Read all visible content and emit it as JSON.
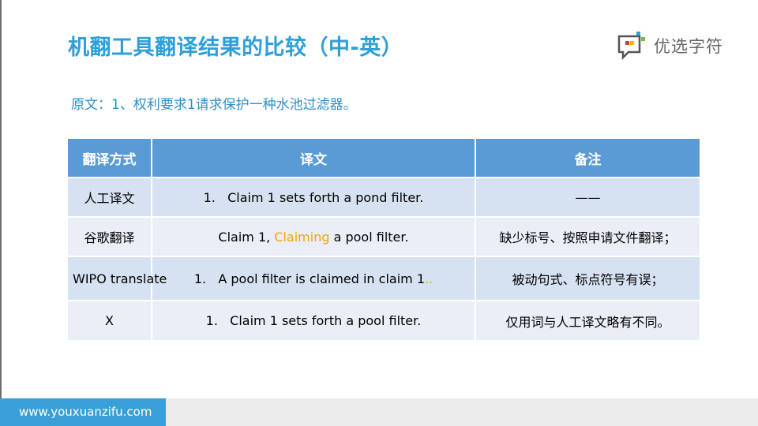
{
  "title": "机翻工具翻译结果的比较（中-英）",
  "logo": {
    "text": "优选字符"
  },
  "source_text": "原文：1、权利要求1请求保护一种水池过滤器。",
  "table": {
    "headers": [
      "翻译方式",
      "译文",
      "备注"
    ],
    "rows": [
      {
        "method": "人工译文",
        "text_pre": "1.   Claim 1 sets forth a pond filter.",
        "text_hl": "",
        "text_post": "",
        "note": "——"
      },
      {
        "method": "谷歌翻译",
        "text_pre": "Claim 1, ",
        "text_hl": "Claiming",
        "text_post": " a pool filter.",
        "note": "缺少标号、按照申请文件翻译；"
      },
      {
        "method": "WIPO translate",
        "text_pre": "1.   A pool filter is claimed in claim 1",
        "text_hl": "..",
        "text_post": "",
        "note": "被动句式、标点符号有误；"
      },
      {
        "method": "X",
        "text_pre": "1.   Claim 1 sets forth a pool filter.",
        "text_hl": "",
        "text_post": "",
        "note": "仅用词与人工译文略有不同。"
      }
    ]
  },
  "footer": {
    "url": "www.youxuanzifu.com"
  },
  "colors": {
    "title": "#2e9fd8",
    "header_bg": "#5b9bd5",
    "row_odd": "#d6e2f1",
    "row_even": "#eaeff7",
    "highlight": "#f0a500",
    "footer_accent": "#3a9fd8"
  }
}
